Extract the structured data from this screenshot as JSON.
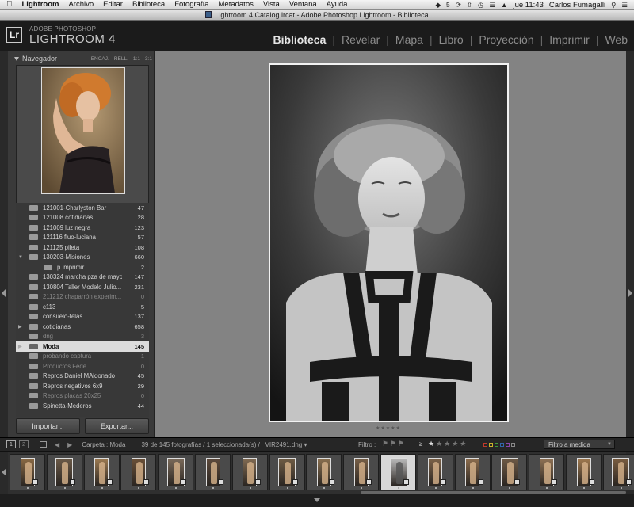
{
  "menubar": {
    "apple_icon": "apple-icon",
    "items": [
      "Lightroom",
      "Archivo",
      "Editar",
      "Biblioteca",
      "Fotografía",
      "Metadatos",
      "Vista",
      "Ventana",
      "Ayuda"
    ],
    "status_5": "5",
    "clock": "jue 11:43",
    "user": "Carlos Fumagalli"
  },
  "window": {
    "title": "Lightroom 4 Catalog.lrcat - Adobe Photoshop Lightroom - Biblioteca"
  },
  "header": {
    "logo": "Lr",
    "brand_top": "ADOBE PHOTOSHOP",
    "brand_main": "LIGHTROOM 4",
    "modules": [
      "Biblioteca",
      "Revelar",
      "Mapa",
      "Libro",
      "Proyección",
      "Imprimir",
      "Web"
    ],
    "active_module": "Biblioteca"
  },
  "navigator": {
    "title": "Navegador",
    "zoom_options": [
      "ENCAJ.",
      "RELL.",
      "1:1",
      "3:1"
    ]
  },
  "folders": [
    {
      "name": "121001-Charlyston Bar",
      "count": "47",
      "dim": false
    },
    {
      "name": "121008 cotidianas",
      "count": "28",
      "dim": false
    },
    {
      "name": "121009 luz negra",
      "count": "123",
      "dim": false
    },
    {
      "name": "121116 fluo-luciana",
      "count": "57",
      "dim": false
    },
    {
      "name": "121125 pileta",
      "count": "108",
      "dim": false
    },
    {
      "name": "130203-Misiones",
      "count": "660",
      "dim": false,
      "expanded": true
    },
    {
      "name": "p imprimir",
      "count": "2",
      "dim": false,
      "indent": true
    },
    {
      "name": "130324 marcha pza de mayo",
      "count": "147",
      "dim": false
    },
    {
      "name": "130804 Taller Modelo Julio...",
      "count": "231",
      "dim": false
    },
    {
      "name": "211212 chaparrón experim...",
      "count": "0",
      "dim": true
    },
    {
      "name": "c113",
      "count": "5",
      "dim": false
    },
    {
      "name": "consuelo-telas",
      "count": "137",
      "dim": false
    },
    {
      "name": "cotidianas",
      "count": "658",
      "dim": false,
      "collapsed": true
    },
    {
      "name": "dng",
      "count": "3",
      "dim": true
    },
    {
      "name": "Moda",
      "count": "145",
      "dim": false,
      "selected": true,
      "collapsed": true
    },
    {
      "name": "probando captura",
      "count": "1",
      "dim": true
    },
    {
      "name": "Productos Fede",
      "count": "0",
      "dim": true
    },
    {
      "name": "Repros Daniel MAldonado",
      "count": "45",
      "dim": false
    },
    {
      "name": "Repros negativos 6x9",
      "count": "29",
      "dim": false
    },
    {
      "name": "Repros placas 20x25",
      "count": "0",
      "dim": true
    },
    {
      "name": "Spinetta-Mederos",
      "count": "44",
      "dim": false
    }
  ],
  "panel_buttons": {
    "import": "Importar...",
    "export": "Exportar..."
  },
  "filmstrip_bar": {
    "monitor_1": "1",
    "monitor_2": "2",
    "breadcrumb": "Carpeta : Moda",
    "photo_count": "39 de 145 fotografías / 1 seleccionada(s) / _VIR2491.dng ▾",
    "filter_label": "Filtro :",
    "rating_op": "≥",
    "custom_filter": "Filtro a medida"
  },
  "filmstrip": {
    "count": 17,
    "selected_index": 10
  },
  "colors": {
    "accent_text": "#e6e6e6",
    "panel_bg": "#3a3a3a",
    "loupe_bg": "#838383",
    "label_colors": [
      "#c0392b",
      "#c9b12a",
      "#3f9a3a",
      "#3366aa",
      "#8e44ad",
      "#888888"
    ]
  }
}
